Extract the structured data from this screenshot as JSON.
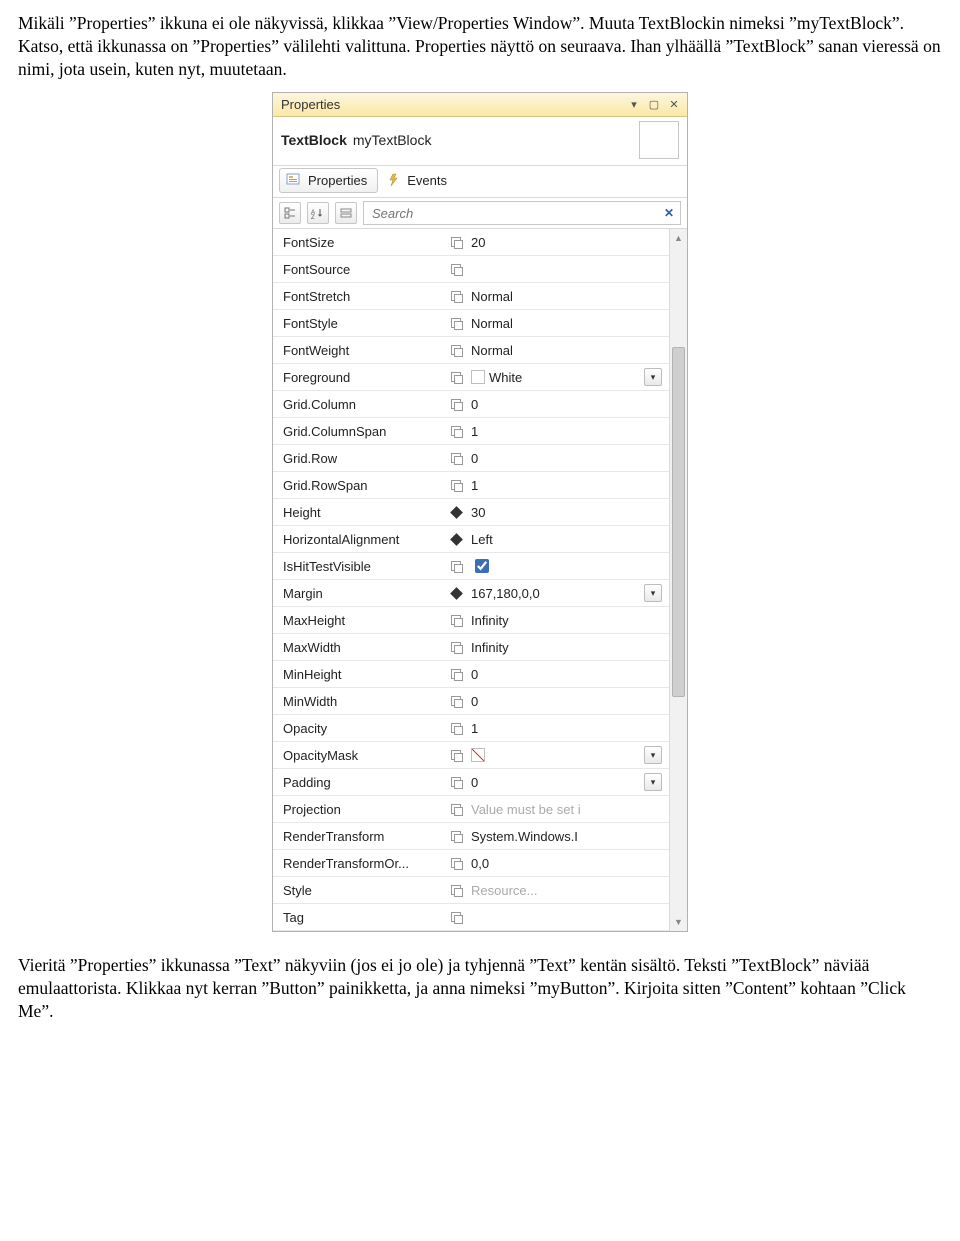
{
  "doc": {
    "para1": "Mikäli ”Properties” ikkuna ei ole näkyvissä, klikkaa ”View/Properties Window”. Muuta TextBlockin nimeksi ”myTextBlock”. Katso, että ikkunassa on ”Properties” välilehti valittuna. Properties näyttö on seuraava. Ihan ylhäällä ”TextBlock” sanan vieressä on nimi, jota usein, kuten nyt, muutetaan.",
    "para2": "Vieritä ”Properties” ikkunassa ”Text” näkyviin (jos ei jo ole) ja tyhjennä ”Text” kentän sisältö. Teksti ”TextBlock” näviää emulaattorista. Klikkaa nyt kerran ”Button” painikketta, ja anna nimeksi ”myButton”. Kirjoita sitten ”Content” kohtaan ”Click Me”."
  },
  "panel": {
    "title": "Properties",
    "typeLabel": "TextBlock",
    "instanceName": "myTextBlock",
    "tabs": {
      "properties": "Properties",
      "events": "Events"
    },
    "searchPlaceholder": "Search",
    "rows": [
      {
        "name": "FontSize",
        "marker": "sq",
        "value": "20"
      },
      {
        "name": "FontSource",
        "marker": "sq",
        "value": ""
      },
      {
        "name": "FontStretch",
        "marker": "sq",
        "value": "Normal"
      },
      {
        "name": "FontStyle",
        "marker": "sq",
        "value": "Normal"
      },
      {
        "name": "FontWeight",
        "marker": "sq",
        "value": "Normal"
      },
      {
        "name": "Foreground",
        "marker": "sq",
        "value": "White",
        "swatch": "white",
        "dropdown": true
      },
      {
        "name": "Grid.Column",
        "marker": "sq",
        "value": "0"
      },
      {
        "name": "Grid.ColumnSpan",
        "marker": "sq",
        "value": "1"
      },
      {
        "name": "Grid.Row",
        "marker": "sq",
        "value": "0"
      },
      {
        "name": "Grid.RowSpan",
        "marker": "sq",
        "value": "1"
      },
      {
        "name": "Height",
        "marker": "diamond",
        "value": "30"
      },
      {
        "name": "HorizontalAlignment",
        "marker": "diamond",
        "value": "Left"
      },
      {
        "name": "IsHitTestVisible",
        "marker": "sq",
        "checkbox": true,
        "checked": true
      },
      {
        "name": "Margin",
        "marker": "diamond",
        "value": "167,180,0,0",
        "dropdown": true
      },
      {
        "name": "MaxHeight",
        "marker": "sq",
        "value": "Infinity"
      },
      {
        "name": "MaxWidth",
        "marker": "sq",
        "value": "Infinity"
      },
      {
        "name": "MinHeight",
        "marker": "sq",
        "value": "0"
      },
      {
        "name": "MinWidth",
        "marker": "sq",
        "value": "0"
      },
      {
        "name": "Opacity",
        "marker": "sq",
        "value": "1"
      },
      {
        "name": "OpacityMask",
        "marker": "sq",
        "swatch": "slash",
        "dropdown": true
      },
      {
        "name": "Padding",
        "marker": "sq",
        "value": "0",
        "dropdown": true
      },
      {
        "name": "Projection",
        "marker": "sq",
        "value": "Value must be set i",
        "placeholder": true
      },
      {
        "name": "RenderTransform",
        "marker": "sq",
        "value": "System.Windows.I"
      },
      {
        "name": "RenderTransformOr...",
        "marker": "sq",
        "value": "0,0"
      },
      {
        "name": "Style",
        "marker": "sq",
        "value": "Resource...",
        "placeholder": true
      },
      {
        "name": "Tag",
        "marker": "sq",
        "value": ""
      }
    ]
  }
}
